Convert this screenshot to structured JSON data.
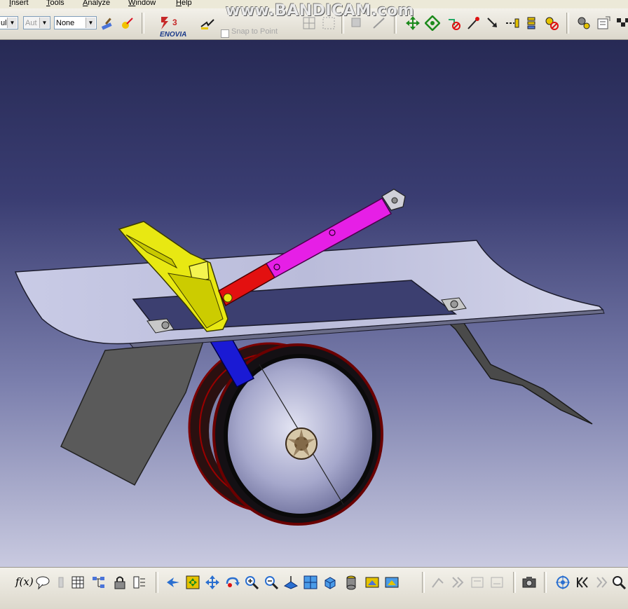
{
  "menu": {
    "insert": "Insert",
    "tools": "Tools",
    "analyze": "Analyze",
    "window": "Window",
    "help": "Help"
  },
  "toolbar": {
    "combo_1": "ul",
    "combo_2": "Aut",
    "combo_3": "None",
    "enovia_label": "ENOVIA",
    "sketch_option": "Snap to Point"
  },
  "watermark": "www.BANDICAM.com",
  "bottom": {
    "formula_label": "f(x)"
  },
  "colors": {
    "viewport_top": "#272a55",
    "viewport_bottom": "#c9cae0",
    "bracket": "#e8e812",
    "actuator_rod": "#e61fe6",
    "actuator_red": "#e31010",
    "blue_strut": "#1a1ad4",
    "shield": "#5a5a5a",
    "panel": "#c8cae6"
  }
}
